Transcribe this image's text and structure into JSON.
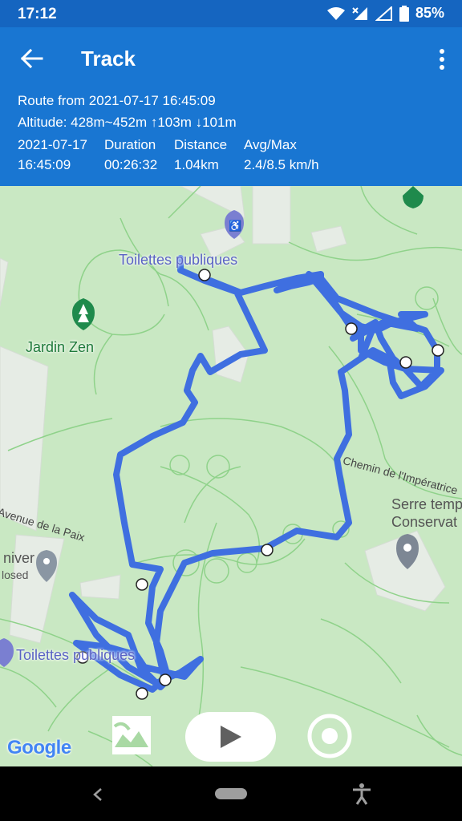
{
  "status_bar": {
    "time": "17:12",
    "battery": "85%"
  },
  "header": {
    "title": "Track",
    "route_line": "Route from 2021-07-17 16:45:09",
    "altitude_line": "Altitude: 428m~452m ↑103m ↓101m",
    "stats": {
      "date": "2021-07-17",
      "start_time": "16:45:09",
      "duration_label": "Duration",
      "duration_value": "00:26:32",
      "distance_label": "Distance",
      "distance_value": "1.04km",
      "speed_label": "Avg/Max",
      "speed_value": "2.4/8.5 km/h"
    }
  },
  "map": {
    "labels": {
      "toilettes_top": "Toilettes publiques",
      "jardin_zen": "Jardin Zen",
      "avenue_paix": "Avenue de la Paix",
      "chemin_imperatrice": "Chemin de l'Impératrice",
      "serre_line1": "Serre temp",
      "serre_line2": "Conservat",
      "univer": "niver",
      "closed": "losed",
      "toilettes_bottom": "Toilettes publiques",
      "google": "Google"
    },
    "colors": {
      "track": "#3f6fe0",
      "park": "#c9e8c3",
      "building": "#e6ece5",
      "path_line": "#8fd28a",
      "label_blue": "#5a63c4",
      "label_green": "#1e7a3a"
    }
  },
  "controls": {
    "gallery_icon": "image-icon",
    "play_icon": "play-icon",
    "record_icon": "record-icon"
  }
}
